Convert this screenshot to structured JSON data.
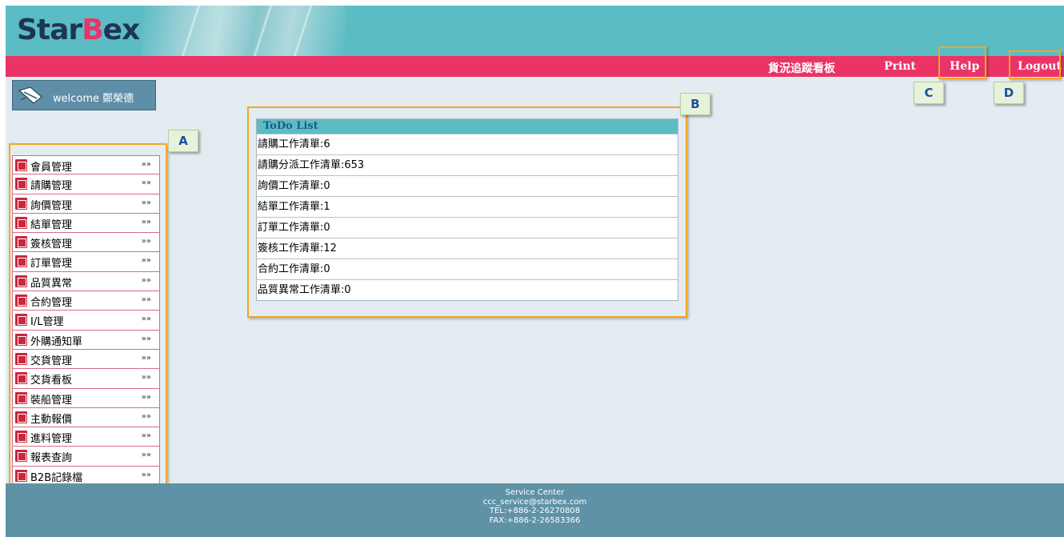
{
  "header": {
    "logo_part1": "Star",
    "logo_part2": "B",
    "logo_part3": "ex"
  },
  "navbar": {
    "tracking_board": "貨況追蹤看板",
    "print": "Print",
    "help": "Help",
    "logout": "Logout"
  },
  "welcome": {
    "text": "welcome 鄭榮德"
  },
  "annotations": {
    "a": "A",
    "b": "B",
    "c": "C",
    "d": "D"
  },
  "menu": {
    "arrow": "»»",
    "items": [
      {
        "label": "會員管理",
        "icon": "member-icon"
      },
      {
        "label": "請購管理",
        "icon": "requisition-icon"
      },
      {
        "label": "詢價管理",
        "icon": "inquiry-icon"
      },
      {
        "label": "結單管理",
        "icon": "close-order-icon"
      },
      {
        "label": "簽核管理",
        "icon": "approval-check-icon"
      },
      {
        "label": "訂單管理",
        "icon": "order-icon"
      },
      {
        "label": "品質異常",
        "icon": "quality-alert-icon"
      },
      {
        "label": "合約管理",
        "icon": "contract-icon"
      },
      {
        "label": "I/L管理",
        "icon": "il-document-icon"
      },
      {
        "label": "外購通知單",
        "icon": "purchase-notice-icon"
      },
      {
        "label": "交貨管理",
        "icon": "delivery-icon"
      },
      {
        "label": "交貨看板",
        "icon": "delivery-board-icon"
      },
      {
        "label": "裝船管理",
        "icon": "shipping-icon"
      },
      {
        "label": "主動報價",
        "icon": "quotation-icon"
      },
      {
        "label": "進料管理",
        "icon": "incoming-material-icon"
      },
      {
        "label": "報表查詢",
        "icon": "report-icon"
      },
      {
        "label": "B2B記錄檔",
        "icon": "b2b-log-icon"
      }
    ]
  },
  "todo": {
    "title": "ToDo List",
    "rows": [
      "請購工作清單:6",
      "請購分派工作清單:653",
      "詢價工作清單:0",
      "結單工作清單:1",
      "訂單工作清單:0",
      "簽核工作清單:12",
      "合約工作清單:0",
      "品質異常工作清單:0"
    ]
  },
  "footer": {
    "title": "Service Center",
    "email": "ccc_service@starbex.com",
    "tel": "TEL:+886-2-26270808",
    "fax": "FAX:+886-2-26583366"
  },
  "colors": {
    "header_teal": "#5cbcc4",
    "nav_pink": "#ea3366",
    "page_bg": "#e3ecf0",
    "footer_blue": "#5f92a6",
    "annotation_orange": "#f5a623",
    "menu_icon_red": "#c8283d"
  }
}
